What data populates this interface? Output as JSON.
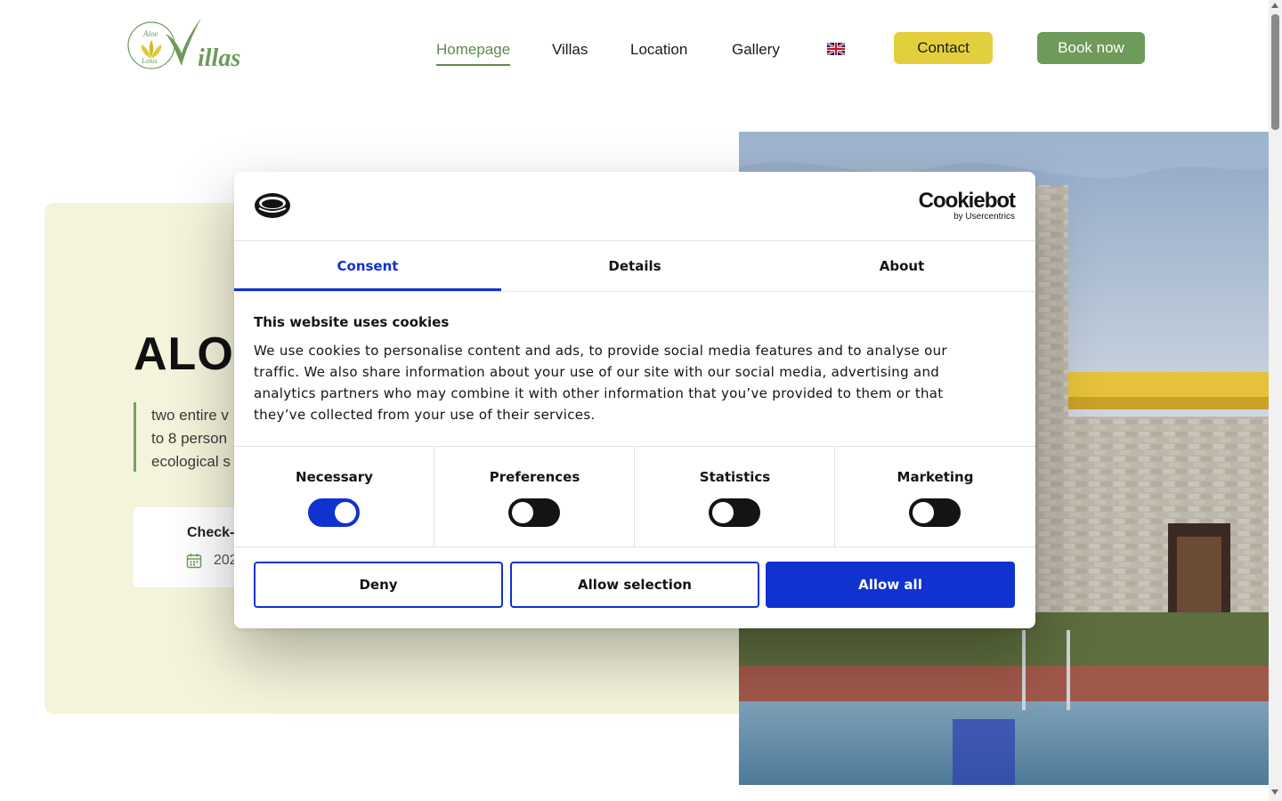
{
  "header": {
    "logo": {
      "word": "illas",
      "alt_top": "Aloe",
      "alt_bottom": "Lotus"
    },
    "nav": [
      {
        "label": "Homepage",
        "active": true
      },
      {
        "label": "Villas",
        "active": false
      },
      {
        "label": "Location",
        "active": false
      },
      {
        "label": "Gallery",
        "active": false
      }
    ],
    "language_icon": "uk-flag-icon",
    "contact_label": "Contact",
    "book_label": "Book now"
  },
  "hero": {
    "title": "ALO",
    "description_lines": [
      "two entire v",
      "to 8 person",
      "ecological s"
    ],
    "checkin_label": "Check-",
    "checkin_date": "202",
    "calendar_icon": "calendar-icon"
  },
  "cookie_dialog": {
    "brand_name": "Cookiebot",
    "brand_sub": "by Usercentrics",
    "tabs": [
      {
        "label": "Consent",
        "active": true
      },
      {
        "label": "Details",
        "active": false
      },
      {
        "label": "About",
        "active": false
      }
    ],
    "heading": "This website uses cookies",
    "body_lines": [
      "We use cookies to personalise content and ads, to provide social media features and to analyse our",
      "traffic. We also share information about your use of our site with our social media, advertising and",
      "analytics partners who may combine it with other information that you’ve provided to them or that",
      "they’ve collected from your use of their services."
    ],
    "categories": [
      {
        "label": "Necessary",
        "enabled": true
      },
      {
        "label": "Preferences",
        "enabled": false
      },
      {
        "label": "Statistics",
        "enabled": false
      },
      {
        "label": "Marketing",
        "enabled": false
      }
    ],
    "buttons": {
      "deny": "Deny",
      "allow_selection": "Allow selection",
      "allow_all": "Allow all"
    }
  },
  "colors": {
    "accent_blue": "#1032cf",
    "brand_green": "#6e9a5a",
    "contact_yellow": "#e3cf3c",
    "hero_panel": "#f4f4dc"
  }
}
